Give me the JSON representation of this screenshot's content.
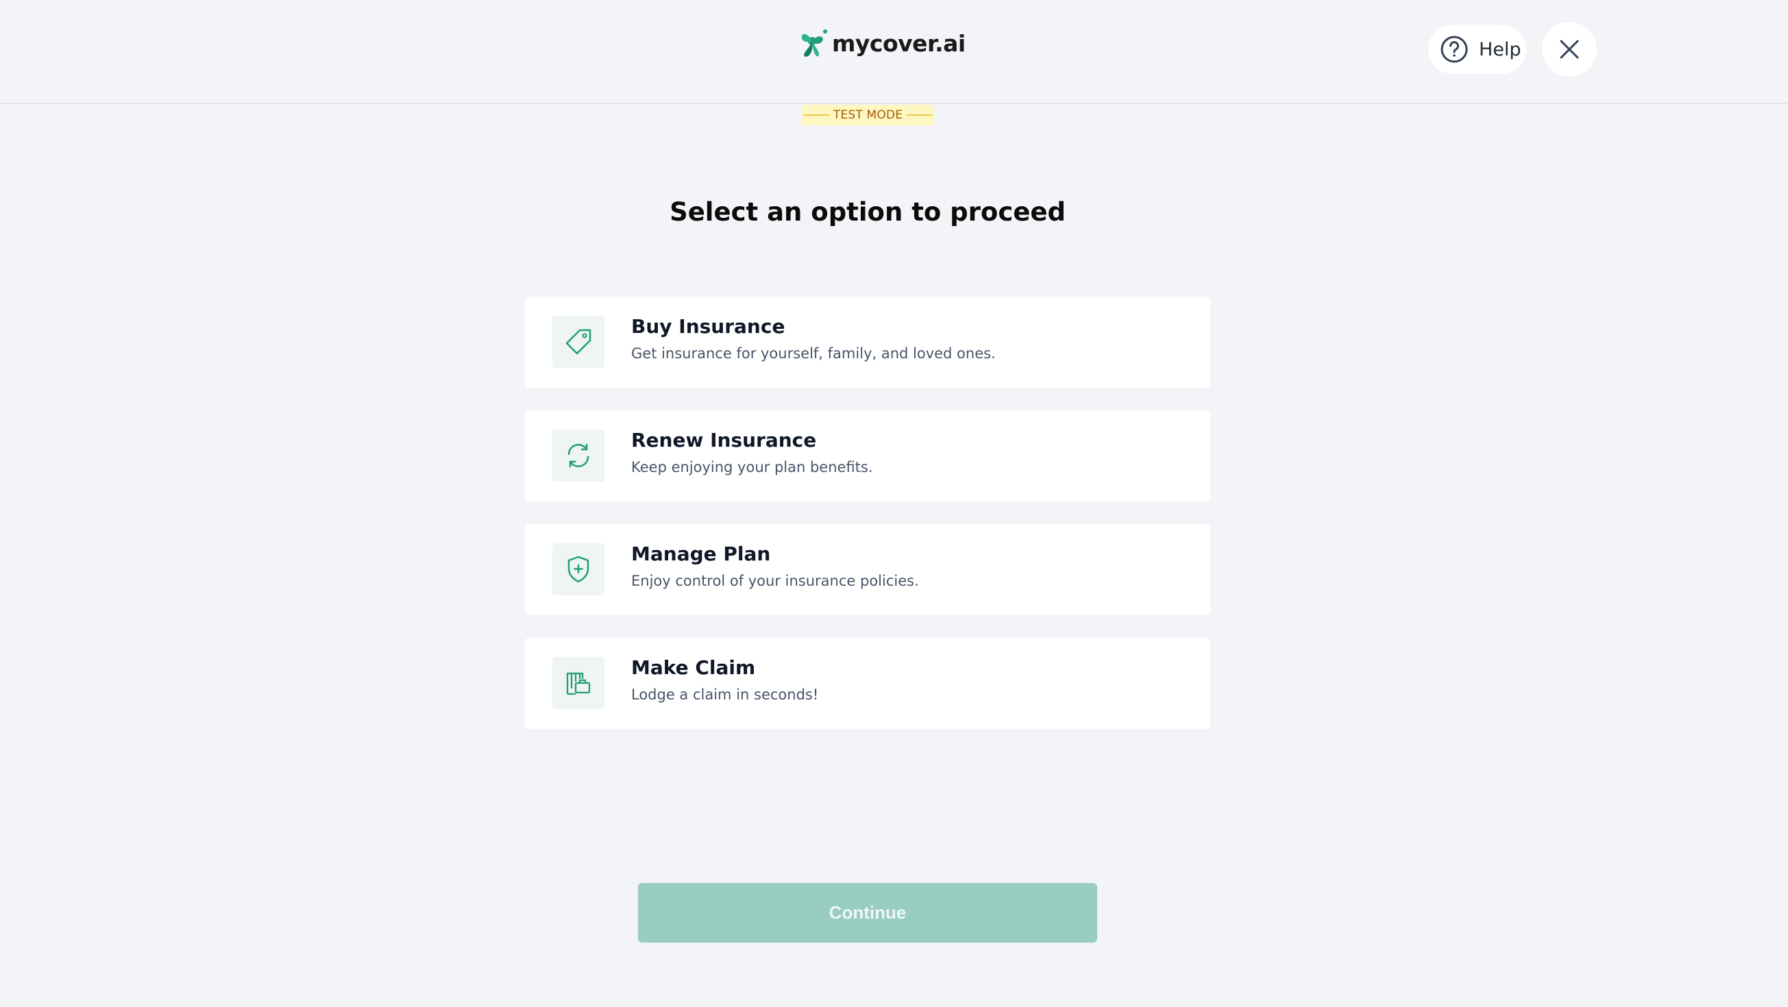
{
  "header": {
    "logo_text": "mycover.ai",
    "help_label": "Help",
    "close_icon": "close-icon"
  },
  "test_mode": {
    "label": "TEST MODE"
  },
  "main": {
    "title": "Select an option to proceed",
    "options": [
      {
        "title": "Buy Insurance",
        "description": "Get insurance for yourself, family, and loved ones.",
        "icon": "tag-icon"
      },
      {
        "title": "Renew Insurance",
        "description": "Keep enjoying your plan benefits.",
        "icon": "refresh-icon"
      },
      {
        "title": "Manage Plan",
        "description": "Enjoy control of your insurance policies.",
        "icon": "shield-plus-icon"
      },
      {
        "title": "Make Claim",
        "description": "Lodge a claim in seconds!",
        "icon": "claim-icon"
      }
    ],
    "continue_label": "Continue"
  },
  "colors": {
    "accent": "#1f9e78",
    "background": "#f2f4f7",
    "continue_disabled": "#98cdc0",
    "test_mode_bg": "#fff7c2"
  }
}
